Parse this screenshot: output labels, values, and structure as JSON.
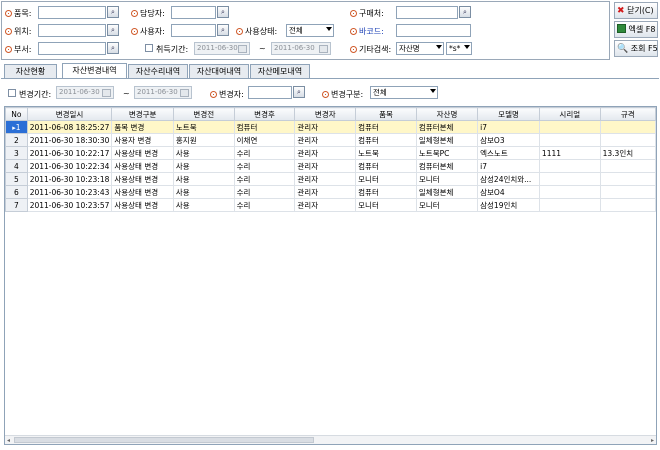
{
  "filters": {
    "item_label": "품목:",
    "location_label": "위치:",
    "dept_label": "부서:",
    "manager_label": "담당자:",
    "user_label": "사용자:",
    "acquire_label": "취득기간:",
    "status_label": "사용상태:",
    "status_value": "전체",
    "buyer_label": "구매처:",
    "barcode_label": "바코드:",
    "other_search_label": "기타검색:",
    "other_search_field": "자산명",
    "other_search_value": "*s*",
    "acquire_from": "2011-06-30",
    "acquire_to": "2011-06-30",
    "tilde": "~"
  },
  "actions": {
    "close_label": "닫기(C)",
    "excel_label": "엑셀 F8",
    "search_label": "조회 F5"
  },
  "tabs": [
    "자산현황",
    "자산변경내역",
    "자산수리내역",
    "자산대여내역",
    "자산메모내역"
  ],
  "subfilters": {
    "change_period_label": "변경기간:",
    "from": "2011-06-30",
    "to": "2011-06-30",
    "tilde": "~",
    "changer_label": "변경자:",
    "change_type_label": "변경구분:",
    "change_type_value": "전체"
  },
  "table": {
    "columns": [
      "No",
      "변경일시",
      "변경구분",
      "변경전",
      "변경후",
      "변경자",
      "품목",
      "자산명",
      "모델명",
      "시리얼",
      "규격"
    ],
    "rows": [
      [
        "1",
        "2011-06-08 18:25:27",
        "품목 변경",
        "노트북",
        "컴퓨터",
        "관리자",
        "컴퓨터",
        "컴퓨터본체",
        "i7",
        "",
        ""
      ],
      [
        "2",
        "2011-06-30 18:30:30",
        "사용자 변경",
        "홍지원",
        "이채연",
        "관리자",
        "컴퓨터",
        "일체형본체",
        "삼보O3",
        "",
        ""
      ],
      [
        "3",
        "2011-06-30 10:22:17",
        "사용상태 변경",
        "사용",
        "수리",
        "관리자",
        "노트북",
        "노트북PC",
        "엑스노트",
        "1111",
        "13.3인치"
      ],
      [
        "4",
        "2011-06-30 10:22:34",
        "사용상태 변경",
        "사용",
        "수리",
        "관리자",
        "컴퓨터",
        "컴퓨터본체",
        "i7",
        "",
        ""
      ],
      [
        "5",
        "2011-06-30 10:23:18",
        "사용상태 변경",
        "사용",
        "수리",
        "관리자",
        "모니터",
        "모니터",
        "삼성24인치와...",
        "",
        ""
      ],
      [
        "6",
        "2011-06-30 10:23:43",
        "사용상태 변경",
        "사용",
        "수리",
        "관리자",
        "컴퓨터",
        "일체형본체",
        "삼보O4",
        "",
        ""
      ],
      [
        "7",
        "2011-06-30 10:23:57",
        "사용상태 변경",
        "사용",
        "수리",
        "관리자",
        "모니터",
        "모니터",
        "삼성19인치",
        "",
        ""
      ]
    ]
  },
  "icons": {
    "lookup": "magnifier-icon",
    "close": "red-x-icon",
    "excel": "excel-icon",
    "search": "search-icon",
    "row_pointer": "row-pointer-icon"
  },
  "colors": {
    "selected_row": "#fff7c8",
    "row_indicator": "#2b6fd6",
    "label_dot": "#d05a2a",
    "barcode_label": "#1a3fb5"
  }
}
